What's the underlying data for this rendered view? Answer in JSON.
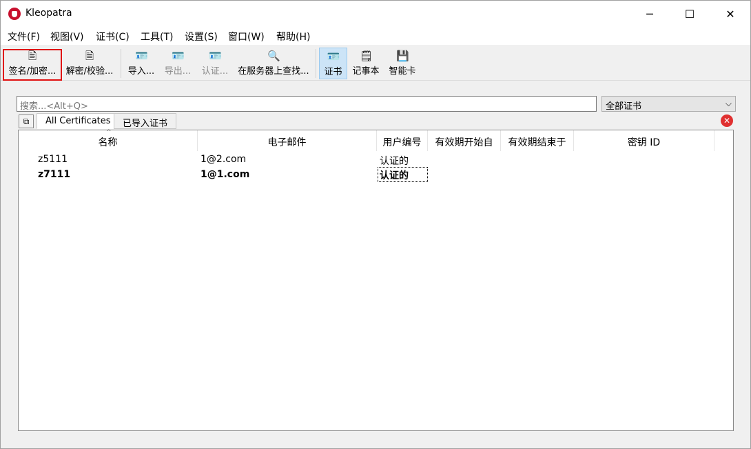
{
  "window": {
    "title": "Kleopatra",
    "minimize_glyph": "─",
    "maximize_glyph": "☐",
    "close_glyph": "✕"
  },
  "menu": [
    "文件(F)",
    "视图(V)",
    "证书(C)",
    "工具(T)",
    "设置(S)",
    "窗口(W)",
    "帮助(H)"
  ],
  "toolbar": {
    "sign_encrypt": {
      "label": "签名/加密...",
      "icon": "sign-encrypt-icon",
      "glyph": "🖹"
    },
    "decrypt_verify": {
      "label": "解密/校验...",
      "icon": "decrypt-verify-icon",
      "glyph": "🗎"
    },
    "import": {
      "label": "导入...",
      "icon": "import-icon",
      "glyph": "🪪"
    },
    "export": {
      "label": "导出...",
      "icon": "export-icon",
      "glyph": "🪪"
    },
    "certify": {
      "label": "认证...",
      "icon": "certify-icon",
      "glyph": "🪪"
    },
    "lookup_server": {
      "label": "在服务器上查找...",
      "icon": "search-icon",
      "glyph": "🔍"
    },
    "certificates": {
      "label": "证书",
      "icon": "certificate-icon",
      "glyph": "🪪"
    },
    "notepad": {
      "label": "记事本",
      "icon": "notepad-icon",
      "glyph": "🗒"
    },
    "smartcards": {
      "label": "智能卡",
      "icon": "smartcard-icon",
      "glyph": "💾"
    }
  },
  "search": {
    "placeholder": "搜索...<Alt+Q>"
  },
  "filter": {
    "selected": "全部证书",
    "arrow": "⌵"
  },
  "tabs": [
    {
      "label": "All Certificates"
    },
    {
      "label": "已导入证书"
    }
  ],
  "tab_controls": {
    "new_tab_glyph": "⧉",
    "close_glyph": "✕"
  },
  "table": {
    "sort_caret": "^",
    "columns": [
      "名称",
      "电子邮件",
      "用户编号",
      "有效期开始自",
      "有效期结束于",
      "密钥 ID"
    ],
    "rows": [
      {
        "name": "z5111",
        "email": "1@2.com",
        "user_id": "认证的"
      },
      {
        "name": "z7111",
        "email": "1@1.com",
        "user_id": "认证的"
      }
    ]
  },
  "colors": {
    "highlight_border": "#e01010",
    "active_toggle": "#cce4f7",
    "close_red": "#e03030"
  }
}
